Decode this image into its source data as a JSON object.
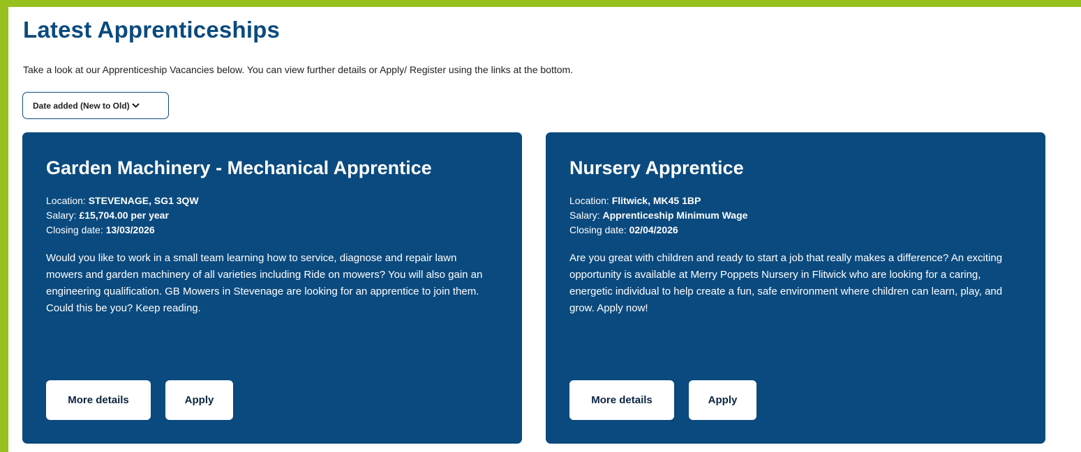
{
  "page": {
    "title": "Latest Apprenticeships",
    "intro": "Take a look at our Apprenticeship Vacancies below. You can view further details or Apply/ Register using the links at the bottom."
  },
  "sort": {
    "selected": "Date added (New to Old)",
    "icon": "chevron-down-icon"
  },
  "labels": {
    "location": "Location:",
    "salary": "Salary:",
    "closing": "Closing date:",
    "more_details": "More details",
    "apply": "Apply"
  },
  "vacancies": [
    {
      "title": "Garden Machinery - Mechanical Apprentice",
      "location": "STEVENAGE, SG1 3QW",
      "salary": "£15,704.00 per year",
      "closing_date": "13/03/2026",
      "description": "Would you like to work in a small team learning how to service, diagnose and repair lawn mowers and garden machinery of all varieties including Ride on mowers? You will also gain an engineering qualification. GB Mowers in Stevenage are looking for an apprentice to join them. Could this be you? Keep reading."
    },
    {
      "title": "Nursery Apprentice",
      "location": "Flitwick, MK45 1BP",
      "salary": "Apprenticeship Minimum Wage",
      "closing_date": "02/04/2026",
      "description": "Are you great with children and ready to start a job that really makes a difference? An exciting opportunity is available at Merry Poppets Nursery in Flitwick who are looking for a caring, energetic individual to help create a fun, safe environment where children can learn, play, and grow. Apply now!"
    }
  ],
  "colors": {
    "page_border": "#97c11f",
    "brand_blue": "#0b4a7e",
    "white": "#ffffff"
  }
}
